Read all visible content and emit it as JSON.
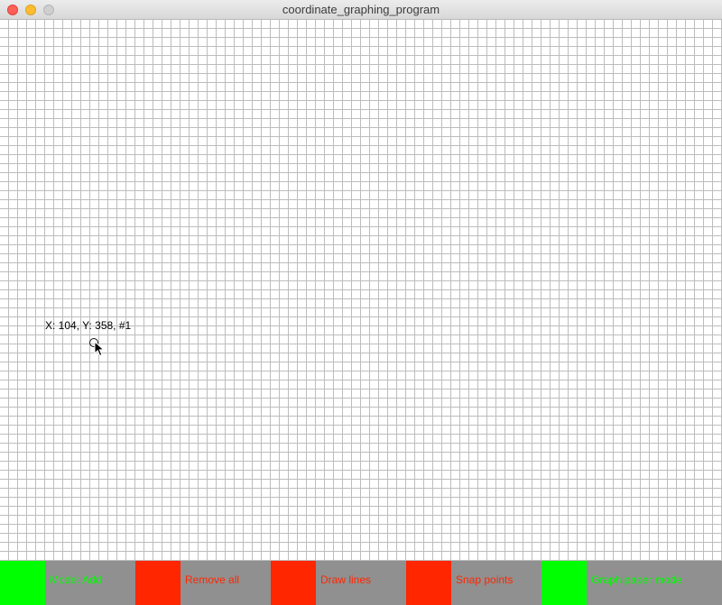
{
  "window": {
    "title": "coordinate_graphing_program"
  },
  "canvas": {
    "readout": "X: 104, Y: 358, #1"
  },
  "toolbar": {
    "buttons": [
      {
        "label": "Mode: Add",
        "state_color": "#00ff00"
      },
      {
        "label": "Remove all",
        "state_color": "#ff2600"
      },
      {
        "label": "Draw lines",
        "state_color": "#ff2600"
      },
      {
        "label": "Snap points",
        "state_color": "#ff2600"
      },
      {
        "label": "Graph paper mode",
        "state_color": "#00ff00"
      }
    ]
  },
  "colors": {
    "toolbar_background": "#909090",
    "grid_line": "#bdbdbd",
    "on": "#00ff00",
    "off": "#ff2600"
  }
}
